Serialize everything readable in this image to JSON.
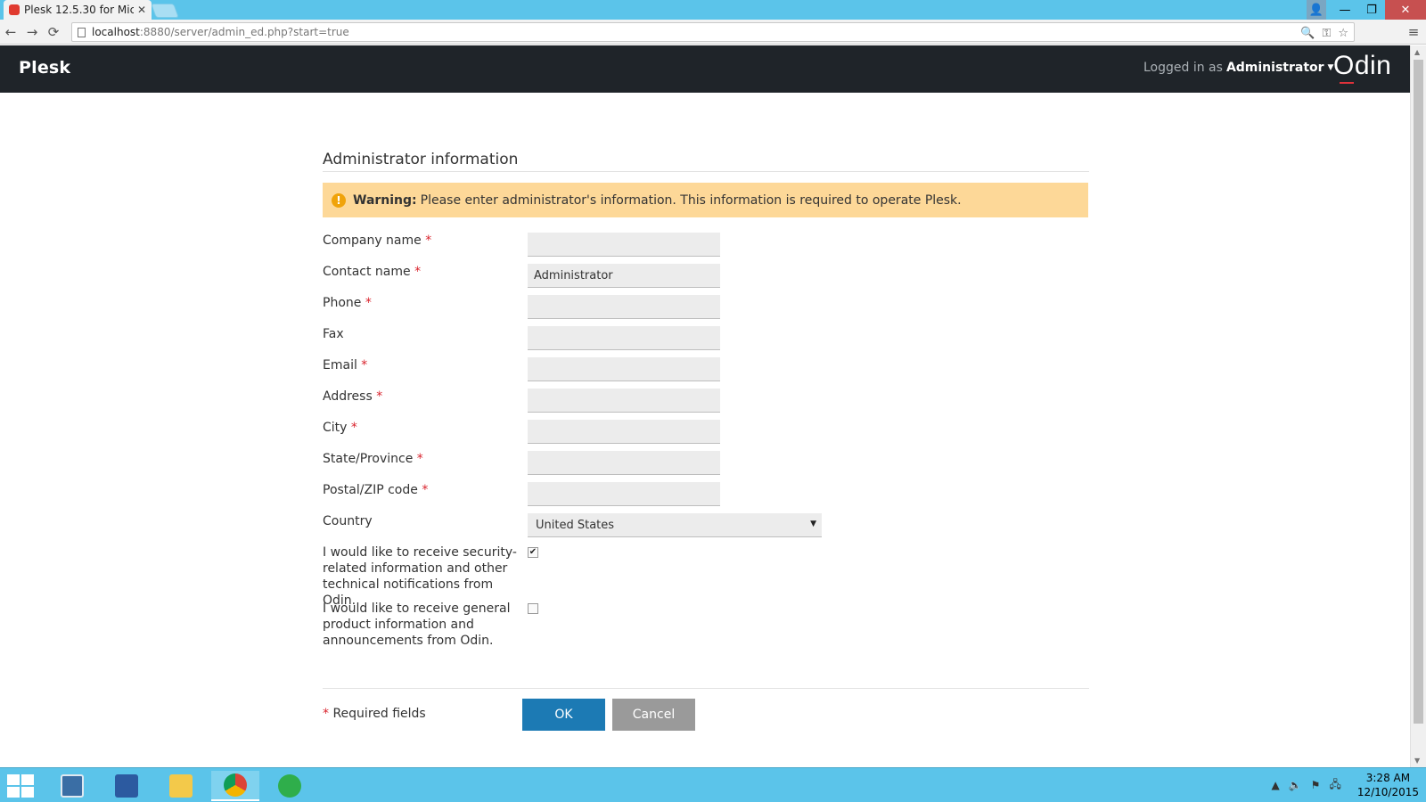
{
  "browser": {
    "tab_title": "Plesk 12.5.30 for Mic",
    "tab_close": "✕",
    "url_host": "localhost",
    "url_path": ":8880/server/admin_ed.php?start=true",
    "back": "←",
    "forward": "→",
    "reload": "⟳",
    "zoom_icon": "🔍",
    "key_icon": "⚿",
    "star_icon": "☆",
    "menu_icon": "≡"
  },
  "header": {
    "logo": "Plesk",
    "logged_in_label": "Logged in as",
    "user": "Administrator",
    "brand": "Odin"
  },
  "form": {
    "title": "Administrator information",
    "warning_label": "Warning:",
    "warning_text": "Please enter administrator's information. This information is required to operate Plesk.",
    "fields": [
      {
        "label": "Company name",
        "value": ""
      },
      {
        "label": "Contact name",
        "value": "Administrator"
      },
      {
        "label": "Phone",
        "value": ""
      },
      {
        "label": "Fax",
        "value": ""
      },
      {
        "label": "Email",
        "value": ""
      },
      {
        "label": "Address",
        "value": ""
      },
      {
        "label": "City",
        "value": ""
      },
      {
        "label": "State/Province",
        "value": ""
      },
      {
        "label": "Postal/ZIP code",
        "value": ""
      }
    ],
    "required_marker": "*",
    "country_label": "Country",
    "country_value": "United States",
    "checkbox_security_label": "I would like to receive security-related information and other technical notifications from Odin.",
    "checkbox_security_checked": true,
    "checkbox_general_label": "I would like to receive general product information and announcements from Odin.",
    "checkbox_general_checked": false,
    "required_note": "Required fields",
    "ok_label": "OK",
    "cancel_label": "Cancel"
  },
  "taskbar": {
    "time": "3:28 AM",
    "date": "12/10/2015"
  }
}
